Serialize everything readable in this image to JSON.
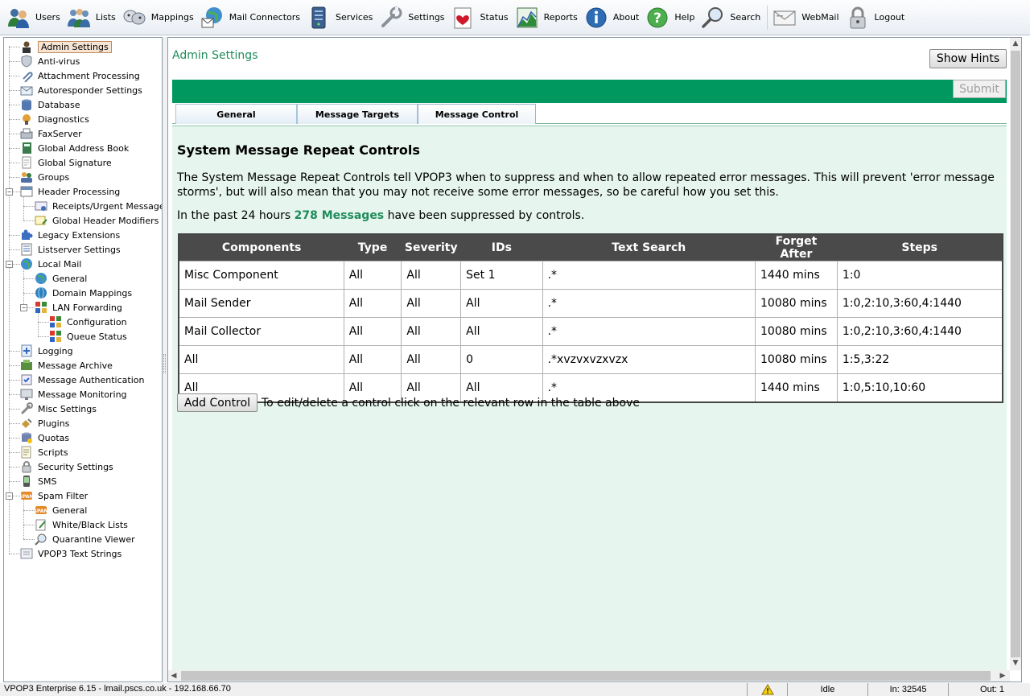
{
  "toolbar": {
    "items": [
      {
        "label": "Users",
        "icon": "users-icon"
      },
      {
        "label": "Lists",
        "icon": "lists-icon"
      },
      {
        "label": "Mappings",
        "icon": "mappings-icon"
      },
      {
        "label": "Mail Connectors",
        "icon": "mail-connectors-icon"
      },
      {
        "label": "Services",
        "icon": "services-icon"
      },
      {
        "label": "Settings",
        "icon": "settings-icon"
      },
      {
        "label": "Status",
        "icon": "status-icon"
      },
      {
        "label": "Reports",
        "icon": "reports-icon"
      },
      {
        "label": "About",
        "icon": "about-icon"
      },
      {
        "label": "Help",
        "icon": "help-icon"
      },
      {
        "label": "Search",
        "icon": "search-icon"
      },
      {
        "label": "WebMail",
        "icon": "webmail-icon"
      },
      {
        "label": "Logout",
        "icon": "logout-icon"
      }
    ]
  },
  "tree": {
    "items": [
      {
        "label": "Admin Settings",
        "selected": true
      },
      {
        "label": "Anti-virus"
      },
      {
        "label": "Attachment Processing"
      },
      {
        "label": "Autoresponder Settings"
      },
      {
        "label": "Database"
      },
      {
        "label": "Diagnostics"
      },
      {
        "label": "FaxServer"
      },
      {
        "label": "Global Address Book"
      },
      {
        "label": "Global Signature"
      },
      {
        "label": "Groups"
      },
      {
        "label": "Header Processing",
        "expander": "minus"
      },
      {
        "label": "Receipts/Urgent Messages"
      },
      {
        "label": "Global Header Modifiers"
      },
      {
        "label": "Legacy Extensions"
      },
      {
        "label": "Listserver Settings"
      },
      {
        "label": "Local Mail",
        "expander": "minus"
      },
      {
        "label": "General"
      },
      {
        "label": "Domain Mappings"
      },
      {
        "label": "LAN Forwarding",
        "expander": "minus"
      },
      {
        "label": "Configuration"
      },
      {
        "label": "Queue Status"
      },
      {
        "label": "Logging"
      },
      {
        "label": "Message Archive"
      },
      {
        "label": "Message Authentication"
      },
      {
        "label": "Message Monitoring"
      },
      {
        "label": "Misc Settings"
      },
      {
        "label": "Plugins"
      },
      {
        "label": "Quotas"
      },
      {
        "label": "Scripts"
      },
      {
        "label": "Security Settings"
      },
      {
        "label": "SMS"
      },
      {
        "label": "Spam Filter",
        "expander": "minus"
      },
      {
        "label": "General"
      },
      {
        "label": "White/Black Lists"
      },
      {
        "label": "Quarantine Viewer"
      },
      {
        "label": "VPOP3 Text Strings"
      }
    ]
  },
  "main": {
    "title": "Admin Settings",
    "hints_label": "Show Hints",
    "submit_label": "Submit",
    "tabs": [
      {
        "label": "General"
      },
      {
        "label": "Message Targets"
      },
      {
        "label": "Message Control",
        "active": true
      }
    ],
    "section_title": "System Message Repeat Controls",
    "description": "The System Message Repeat Controls tell VPOP3 when to suppress and when to allow repeated error messages. This will prevent 'error message storms', but will also mean that you may not receive some error messages, so be careful how you set this.",
    "stats_prefix": "In the past 24 hours",
    "stats_count": "278 Messages",
    "stats_suffix": "have been suppressed by controls.",
    "table": {
      "headers": [
        "Components",
        "Type",
        "Severity",
        "IDs",
        "Text Search",
        "Forget After",
        "Steps"
      ],
      "rows": [
        [
          "Misc Component",
          "All",
          "All",
          "Set 1",
          ".*",
          "1440 mins",
          "1:0"
        ],
        [
          "Mail Sender",
          "All",
          "All",
          "All",
          ".*",
          "10080 mins",
          "1:0,2:10,3:60,4:1440"
        ],
        [
          "Mail Collector",
          "All",
          "All",
          "All",
          ".*",
          "10080 mins",
          "1:0,2:10,3:60,4:1440"
        ],
        [
          "All",
          "All",
          "All",
          "0",
          ".*xvzvxvzxvzx",
          "10080 mins",
          "1:5,3:22"
        ],
        [
          "All",
          "All",
          "All",
          "All",
          ".*",
          "1440 mins",
          "1:0,5:10,10:60"
        ]
      ]
    },
    "add_label": "Add Control",
    "add_hint": "To edit/delete a control click on the relevant row in the table above"
  },
  "statusbar": {
    "left": "VPOP3 Enterprise 6.15 - lmail.pscs.co.uk - 192.168.66.70",
    "state": "Idle",
    "in": "In: 32545",
    "out": "Out: 1"
  },
  "colors": {
    "accent_green": "#00985f",
    "title_green": "#1f8c5a",
    "content_bg": "#e6f5ee",
    "header_dark": "#4a4a4a"
  }
}
